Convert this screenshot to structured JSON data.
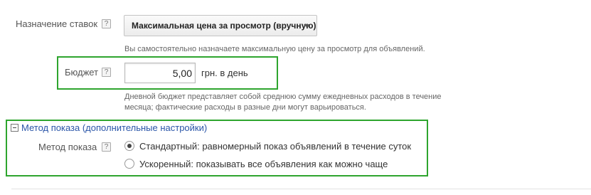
{
  "bidding": {
    "label": "Назначение ставок",
    "help": "?",
    "button_label": "Максимальная цена за просмотр (вручную)",
    "hint": "Вы самостоятельно назначаете максимальную цену за просмотр для объявлений."
  },
  "budget": {
    "label": "Бюджет",
    "help": "?",
    "value": "5,00",
    "unit": "грн. в день",
    "hint_line1": "Дневной бюджет представляет собой среднюю сумму ежедневных расходов в течение",
    "hint_line2": "месяца; фактические расходы в разные дни могут варьироваться."
  },
  "delivery": {
    "section_title": "Метод показа (дополнительные настройки)",
    "label": "Метод показа",
    "help": "?",
    "options": [
      {
        "label": "Стандартный: равномерный показ объявлений в течение суток",
        "checked": true
      },
      {
        "label": "Ускоренный: показывать все объявления как можно чаще",
        "checked": false
      }
    ]
  },
  "colors": {
    "highlight_border": "#2ea52e",
    "link": "#2a55a8"
  }
}
